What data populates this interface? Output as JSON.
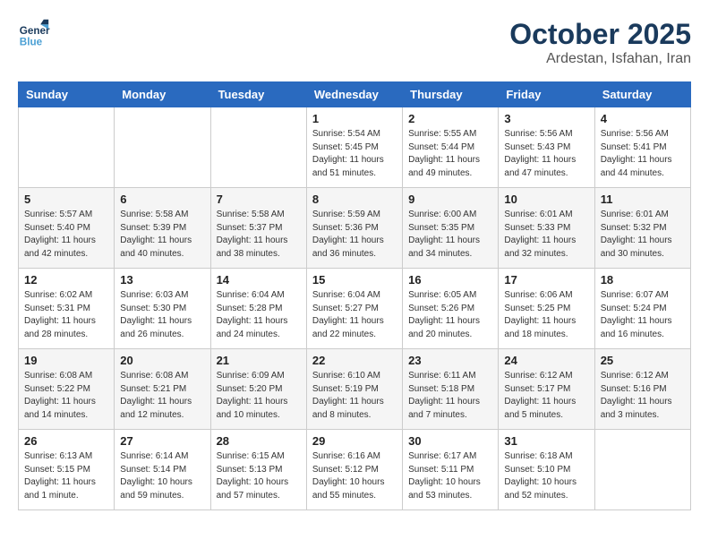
{
  "header": {
    "logo_line1": "General",
    "logo_line2": "Blue",
    "month": "October 2025",
    "location": "Ardestan, Isfahan, Iran"
  },
  "weekdays": [
    "Sunday",
    "Monday",
    "Tuesday",
    "Wednesday",
    "Thursday",
    "Friday",
    "Saturday"
  ],
  "weeks": [
    [
      {
        "day": "",
        "info": ""
      },
      {
        "day": "",
        "info": ""
      },
      {
        "day": "",
        "info": ""
      },
      {
        "day": "1",
        "info": "Sunrise: 5:54 AM\nSunset: 5:45 PM\nDaylight: 11 hours\nand 51 minutes."
      },
      {
        "day": "2",
        "info": "Sunrise: 5:55 AM\nSunset: 5:44 PM\nDaylight: 11 hours\nand 49 minutes."
      },
      {
        "day": "3",
        "info": "Sunrise: 5:56 AM\nSunset: 5:43 PM\nDaylight: 11 hours\nand 47 minutes."
      },
      {
        "day": "4",
        "info": "Sunrise: 5:56 AM\nSunset: 5:41 PM\nDaylight: 11 hours\nand 44 minutes."
      }
    ],
    [
      {
        "day": "5",
        "info": "Sunrise: 5:57 AM\nSunset: 5:40 PM\nDaylight: 11 hours\nand 42 minutes."
      },
      {
        "day": "6",
        "info": "Sunrise: 5:58 AM\nSunset: 5:39 PM\nDaylight: 11 hours\nand 40 minutes."
      },
      {
        "day": "7",
        "info": "Sunrise: 5:58 AM\nSunset: 5:37 PM\nDaylight: 11 hours\nand 38 minutes."
      },
      {
        "day": "8",
        "info": "Sunrise: 5:59 AM\nSunset: 5:36 PM\nDaylight: 11 hours\nand 36 minutes."
      },
      {
        "day": "9",
        "info": "Sunrise: 6:00 AM\nSunset: 5:35 PM\nDaylight: 11 hours\nand 34 minutes."
      },
      {
        "day": "10",
        "info": "Sunrise: 6:01 AM\nSunset: 5:33 PM\nDaylight: 11 hours\nand 32 minutes."
      },
      {
        "day": "11",
        "info": "Sunrise: 6:01 AM\nSunset: 5:32 PM\nDaylight: 11 hours\nand 30 minutes."
      }
    ],
    [
      {
        "day": "12",
        "info": "Sunrise: 6:02 AM\nSunset: 5:31 PM\nDaylight: 11 hours\nand 28 minutes."
      },
      {
        "day": "13",
        "info": "Sunrise: 6:03 AM\nSunset: 5:30 PM\nDaylight: 11 hours\nand 26 minutes."
      },
      {
        "day": "14",
        "info": "Sunrise: 6:04 AM\nSunset: 5:28 PM\nDaylight: 11 hours\nand 24 minutes."
      },
      {
        "day": "15",
        "info": "Sunrise: 6:04 AM\nSunset: 5:27 PM\nDaylight: 11 hours\nand 22 minutes."
      },
      {
        "day": "16",
        "info": "Sunrise: 6:05 AM\nSunset: 5:26 PM\nDaylight: 11 hours\nand 20 minutes."
      },
      {
        "day": "17",
        "info": "Sunrise: 6:06 AM\nSunset: 5:25 PM\nDaylight: 11 hours\nand 18 minutes."
      },
      {
        "day": "18",
        "info": "Sunrise: 6:07 AM\nSunset: 5:24 PM\nDaylight: 11 hours\nand 16 minutes."
      }
    ],
    [
      {
        "day": "19",
        "info": "Sunrise: 6:08 AM\nSunset: 5:22 PM\nDaylight: 11 hours\nand 14 minutes."
      },
      {
        "day": "20",
        "info": "Sunrise: 6:08 AM\nSunset: 5:21 PM\nDaylight: 11 hours\nand 12 minutes."
      },
      {
        "day": "21",
        "info": "Sunrise: 6:09 AM\nSunset: 5:20 PM\nDaylight: 11 hours\nand 10 minutes."
      },
      {
        "day": "22",
        "info": "Sunrise: 6:10 AM\nSunset: 5:19 PM\nDaylight: 11 hours\nand 8 minutes."
      },
      {
        "day": "23",
        "info": "Sunrise: 6:11 AM\nSunset: 5:18 PM\nDaylight: 11 hours\nand 7 minutes."
      },
      {
        "day": "24",
        "info": "Sunrise: 6:12 AM\nSunset: 5:17 PM\nDaylight: 11 hours\nand 5 minutes."
      },
      {
        "day": "25",
        "info": "Sunrise: 6:12 AM\nSunset: 5:16 PM\nDaylight: 11 hours\nand 3 minutes."
      }
    ],
    [
      {
        "day": "26",
        "info": "Sunrise: 6:13 AM\nSunset: 5:15 PM\nDaylight: 11 hours\nand 1 minute."
      },
      {
        "day": "27",
        "info": "Sunrise: 6:14 AM\nSunset: 5:14 PM\nDaylight: 10 hours\nand 59 minutes."
      },
      {
        "day": "28",
        "info": "Sunrise: 6:15 AM\nSunset: 5:13 PM\nDaylight: 10 hours\nand 57 minutes."
      },
      {
        "day": "29",
        "info": "Sunrise: 6:16 AM\nSunset: 5:12 PM\nDaylight: 10 hours\nand 55 minutes."
      },
      {
        "day": "30",
        "info": "Sunrise: 6:17 AM\nSunset: 5:11 PM\nDaylight: 10 hours\nand 53 minutes."
      },
      {
        "day": "31",
        "info": "Sunrise: 6:18 AM\nSunset: 5:10 PM\nDaylight: 10 hours\nand 52 minutes."
      },
      {
        "day": "",
        "info": ""
      }
    ]
  ]
}
